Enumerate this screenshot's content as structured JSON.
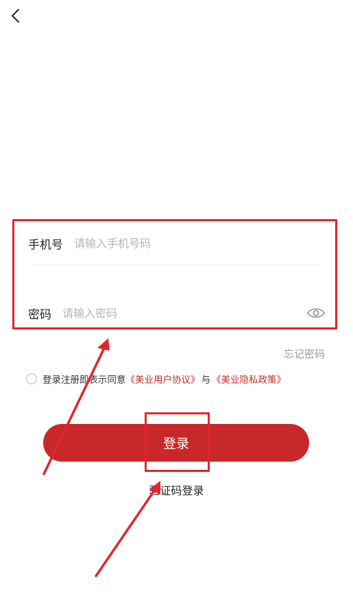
{
  "header": {
    "back_icon": "chevron-left-icon"
  },
  "form": {
    "phone_label": "手机号",
    "phone_placeholder": "请输入手机号码",
    "password_label": "密码",
    "password_placeholder": "请输入密码",
    "toggle_visibility_icon": "eye-icon"
  },
  "forgot_password": "忘记密码",
  "agreement": {
    "prefix": "登录注册即表示同意",
    "user_agreement": "《美业用户协议》",
    "joiner": "与",
    "privacy_policy": "《美业隐私政策》"
  },
  "login_button": "登录",
  "sms_login": "验证码登录",
  "colors": {
    "primary": "#c9282a",
    "annotation": "#e0262a",
    "placeholder": "#b3b3b3",
    "muted": "#9a9a9a"
  }
}
